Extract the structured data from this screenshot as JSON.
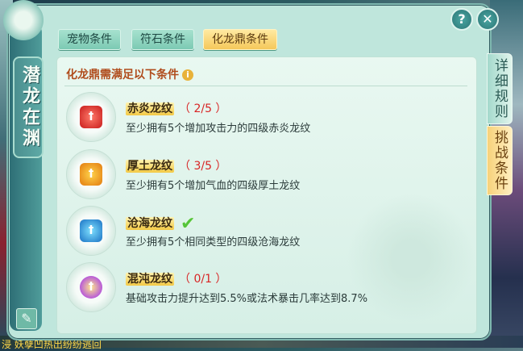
{
  "window": {
    "vertical_title": "潜龙在渊"
  },
  "top_buttons": {
    "help_label": "?",
    "close_label": "✕"
  },
  "tabs": [
    {
      "label": "宠物条件",
      "active": false
    },
    {
      "label": "符石条件",
      "active": false
    },
    {
      "label": "化龙鼎条件",
      "active": true
    }
  ],
  "side_tabs": [
    {
      "label": "详细规则",
      "active": false
    },
    {
      "label": "挑战条件",
      "active": true
    }
  ],
  "content": {
    "header": "化龙鼎需满足以下条件",
    "info_icon": "i",
    "conditions": [
      {
        "name": "赤炎龙纹",
        "progress": "（ 2/5 ）",
        "desc": "至少拥有5个增加攻击力的四级赤炎龙纹",
        "icon": "red-gem-icon",
        "completed": false
      },
      {
        "name": "厚土龙纹",
        "progress": "（ 3/5 ）",
        "desc": "至少拥有5个增加气血的四级厚土龙纹",
        "icon": "orange-gem-icon",
        "completed": false
      },
      {
        "name": "沧海龙纹",
        "progress": "",
        "desc": "至少拥有5个相同类型的四级沧海龙纹",
        "icon": "blue-gem-icon",
        "completed": true
      },
      {
        "name": "混沌龙纹",
        "progress": "（ 0/1 ）",
        "desc": "基础攻击力提升达到5.5%或法术暴击几率达到8.7%",
        "icon": "chaos-gem-icon",
        "completed": false
      }
    ]
  },
  "bottom_bar": {
    "text": "浸  妖孽凹热出纷纷逃回"
  },
  "icons": {
    "check": "✔",
    "gem_glyph": "ꝉ",
    "edit": "✎"
  }
}
